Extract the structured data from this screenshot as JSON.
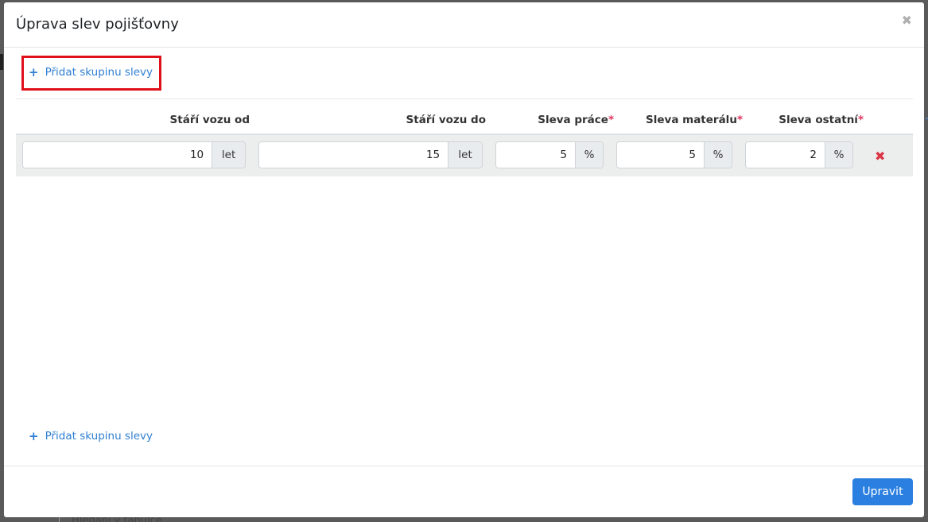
{
  "background": {
    "fragment_text": "Hledání v tabulce"
  },
  "modal": {
    "title": "Úprava slev pojišťovny",
    "close_icon": "close-icon"
  },
  "actions": {
    "add_group_label": "Přidat skupinu slevy",
    "add_group_label_bottom": "Přidat skupinu slevy",
    "plus_icon": "plus-icon"
  },
  "table": {
    "columns": [
      {
        "label": "Stáří vozu od",
        "required": false
      },
      {
        "label": "Stáří vozu do",
        "required": false
      },
      {
        "label": "Sleva práce",
        "required": true
      },
      {
        "label": "Sleva materálu",
        "required": true
      },
      {
        "label": "Sleva ostatní",
        "required": true
      }
    ],
    "required_marker": "*",
    "rows": [
      {
        "age_from": {
          "value": "10",
          "unit": "let"
        },
        "age_to": {
          "value": "15",
          "unit": "let"
        },
        "labor_discount": {
          "value": "5",
          "unit": "%"
        },
        "material_discount": {
          "value": "5",
          "unit": "%"
        },
        "other_discount": {
          "value": "2",
          "unit": "%"
        },
        "delete_icon": "delete-icon"
      }
    ]
  },
  "footer": {
    "submit_label": "Upravit"
  },
  "colors": {
    "accent": "#2a7fe0",
    "required": "#e0335b",
    "highlight": "#e0101a"
  }
}
